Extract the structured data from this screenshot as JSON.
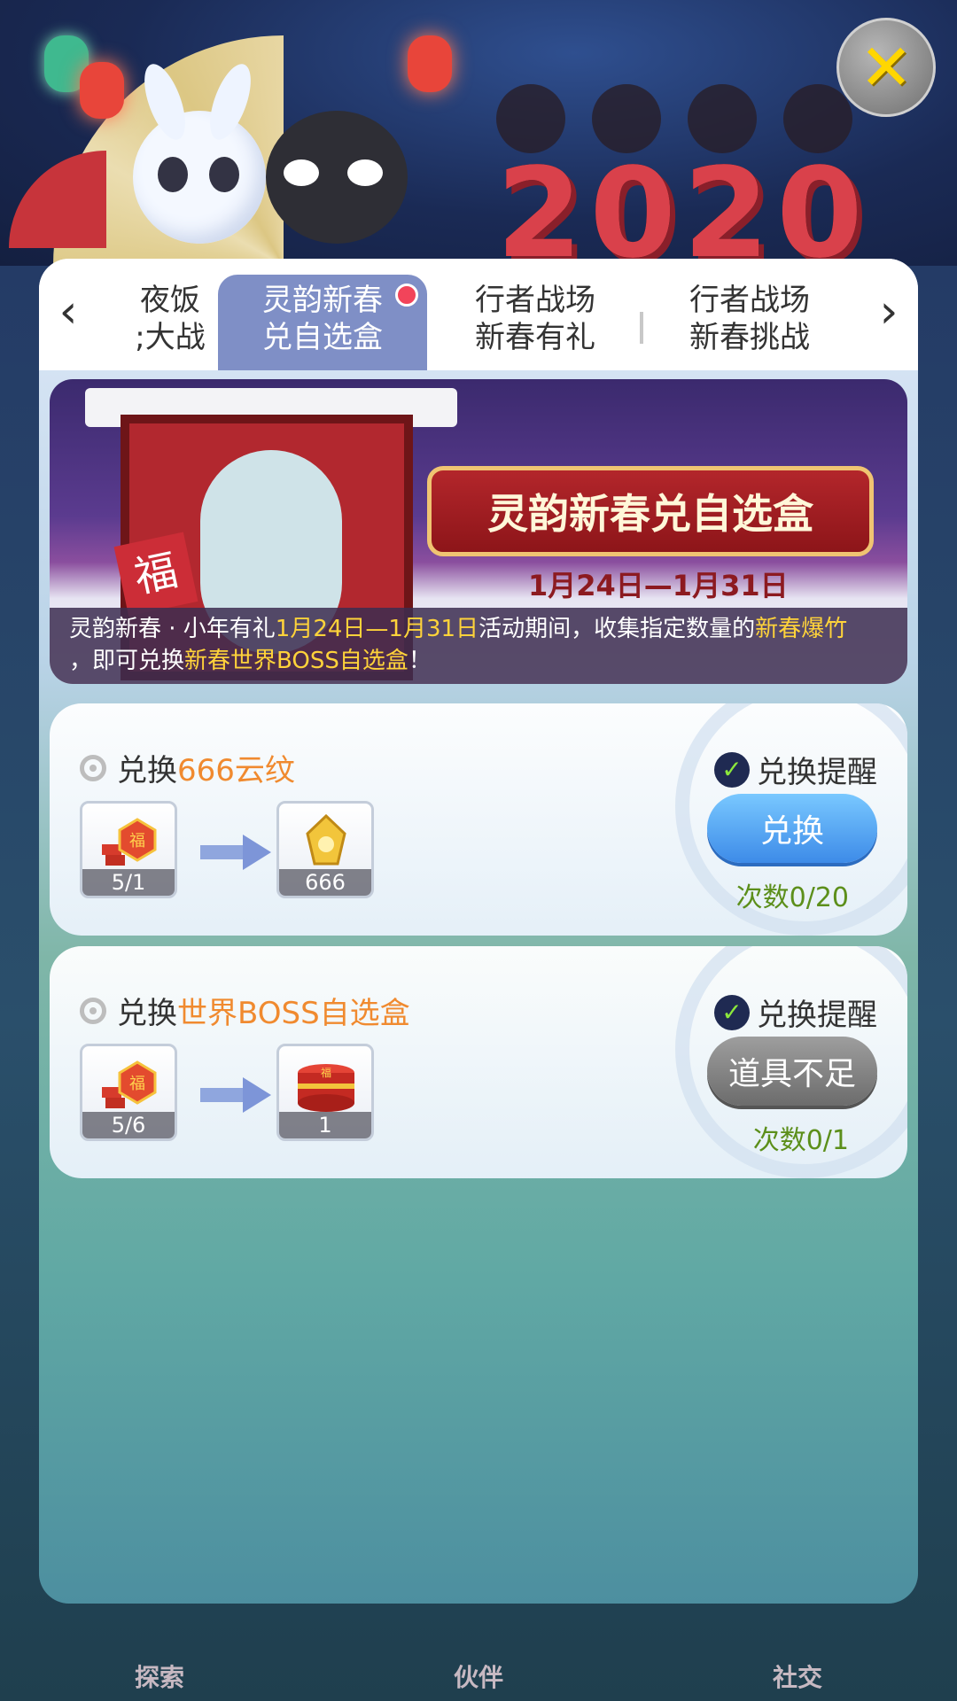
{
  "header": {
    "year_text": "2020",
    "close_label": "✕"
  },
  "tabs": {
    "prev_arrow": "‹",
    "next_arrow": "›",
    "items": [
      {
        "line1": "夜饭",
        "line2": ";大战"
      },
      {
        "line1": "灵韵新春",
        "line2": "兑自选盒",
        "active": true
      },
      {
        "line1": "行者战场",
        "line2": "新春有礼"
      },
      {
        "line1": "行者战场",
        "line2": "新春挑战"
      }
    ]
  },
  "banner": {
    "title": "灵韵新春兑自选盒",
    "date": "1月24日—1月31日",
    "fu_char": "福",
    "desc_a": "灵韵新春 · 小年有礼",
    "desc_b": "1月24日—1月31日",
    "desc_c": "活动期间，收集指定数量的",
    "desc_d": "新春爆竹",
    "desc_e": "，即可兑换",
    "desc_f": "新春世界BOSS自选盒",
    "desc_g": "！"
  },
  "cards": [
    {
      "title_prefix": "兑换",
      "title_item": "666云纹",
      "from_count": "5/1",
      "to_count": "666",
      "remind_label": "兑换提醒",
      "button_label": "兑换",
      "times": "次数0/20"
    },
    {
      "title_prefix": "兑换",
      "title_item": "世界BOSS自选盒",
      "from_count": "5/6",
      "to_count": "1",
      "remind_label": "兑换提醒",
      "button_label": "道具不足",
      "times": "次数0/1"
    }
  ],
  "bottom_nav": [
    "探索",
    "伙伴",
    "社交"
  ],
  "colors": {
    "accent_orange": "#f08a2f",
    "highlight_yellow": "#ffd33a",
    "tab_active": "#7f8fc6",
    "check_green": "#8ce83c"
  }
}
